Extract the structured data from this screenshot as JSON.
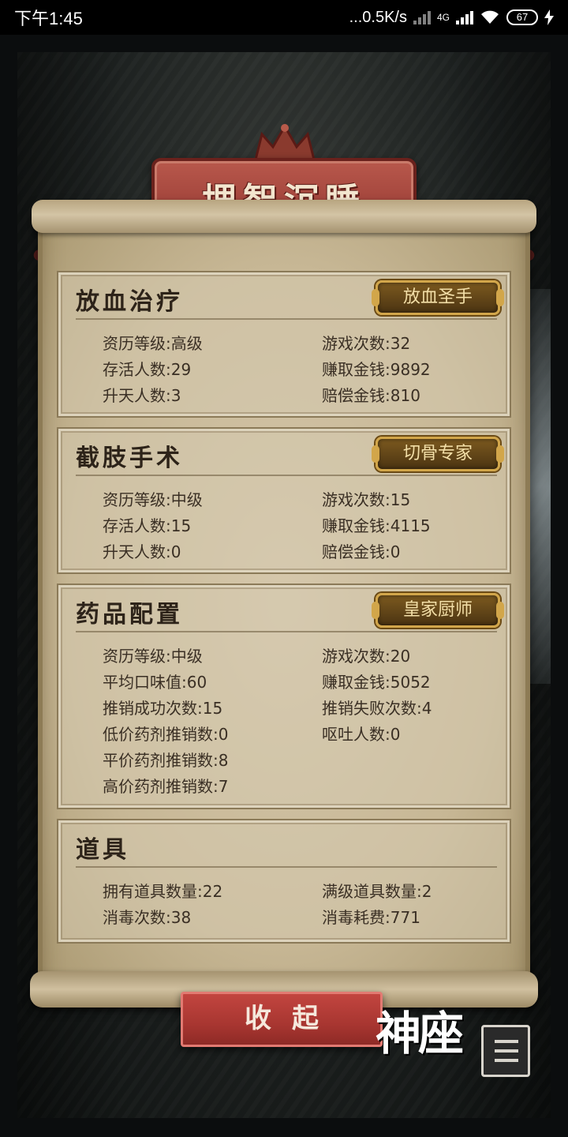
{
  "status_bar": {
    "time": "下午1:45",
    "net_speed": "...0.5K/s",
    "network": "4G",
    "battery": "67"
  },
  "title": "埋智沉睡",
  "sections": [
    {
      "title": "放血治疗",
      "badge": "放血圣手",
      "stats": [
        {
          "label": "资历等级:",
          "value": "高级"
        },
        {
          "label": "游戏次数:",
          "value": "32"
        },
        {
          "label": "存活人数:",
          "value": "29"
        },
        {
          "label": "赚取金钱:",
          "value": "9892"
        },
        {
          "label": "升天人数:",
          "value": "3"
        },
        {
          "label": "赔偿金钱:",
          "value": "810"
        }
      ]
    },
    {
      "title": "截肢手术",
      "badge": "切骨专家",
      "stats": [
        {
          "label": "资历等级:",
          "value": "中级"
        },
        {
          "label": "游戏次数:",
          "value": "15"
        },
        {
          "label": "存活人数:",
          "value": "15"
        },
        {
          "label": "赚取金钱:",
          "value": "4115"
        },
        {
          "label": "升天人数:",
          "value": "0"
        },
        {
          "label": "赔偿金钱:",
          "value": "0"
        }
      ]
    },
    {
      "title": "药品配置",
      "badge": "皇家厨师",
      "stats": [
        {
          "label": "资历等级:",
          "value": "中级"
        },
        {
          "label": "游戏次数:",
          "value": "20"
        },
        {
          "label": "平均口味值:",
          "value": "60"
        },
        {
          "label": "赚取金钱:",
          "value": "5052"
        },
        {
          "label": "推销成功次数:",
          "value": "15"
        },
        {
          "label": "推销失败次数:",
          "value": "4"
        },
        {
          "label": "低价药剂推销数:",
          "value": "0"
        },
        {
          "label": "呕吐人数:",
          "value": "0"
        },
        {
          "label": "平价药剂推销数:",
          "value": "8"
        },
        {
          "label": "高价药剂推销数:",
          "value": "7"
        }
      ]
    },
    {
      "title": "道具",
      "stats": [
        {
          "label": "拥有道具数量:",
          "value": "22"
        },
        {
          "label": "满级道具数量:",
          "value": "2"
        },
        {
          "label": "消毒次数:",
          "value": "38"
        },
        {
          "label": "消毒耗费:",
          "value": "771"
        }
      ]
    }
  ],
  "collapse_label": "收起",
  "logo_text": "神座",
  "colors": {
    "banner_red": "#a2443b",
    "button_red": "#b03a34",
    "badge_gold": "#d2a64a",
    "parchment": "#c7b795"
  },
  "icons": [
    "menu-icon",
    "wifi-icon",
    "signal-icon",
    "battery-icon"
  ]
}
